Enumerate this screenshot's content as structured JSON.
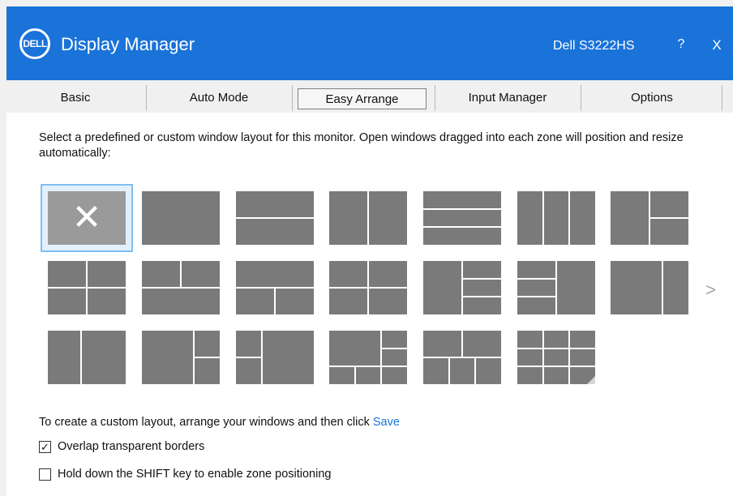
{
  "window": {
    "logo_text": "DELL",
    "title": "Display Manager",
    "monitor": "Dell S3222HS",
    "help_label": "?",
    "close_label": "X"
  },
  "tabs": [
    {
      "label": "Basic",
      "active": false
    },
    {
      "label": "Auto Mode",
      "active": false
    },
    {
      "label": "Easy Arrange",
      "active": true
    },
    {
      "label": "Input Manager",
      "active": false
    },
    {
      "label": "Options",
      "active": false
    }
  ],
  "description": "Select a predefined or custom window layout for this monitor.  Open windows dragged into each zone will position and resize automatically:",
  "layouts": {
    "selected_index": 0,
    "next_label": ">"
  },
  "custom_layout": {
    "text": "To create a custom layout, arrange your windows and then click",
    "save_label": "Save"
  },
  "options": [
    {
      "label": "Overlap transparent borders",
      "checked": true
    },
    {
      "label": "Hold down the SHIFT key to enable zone positioning",
      "checked": false
    }
  ],
  "colors": {
    "title_bar": "#1a73d9",
    "tile": "#7a7a7a",
    "selection": "#7fbef0",
    "link": "#1a73d9"
  }
}
